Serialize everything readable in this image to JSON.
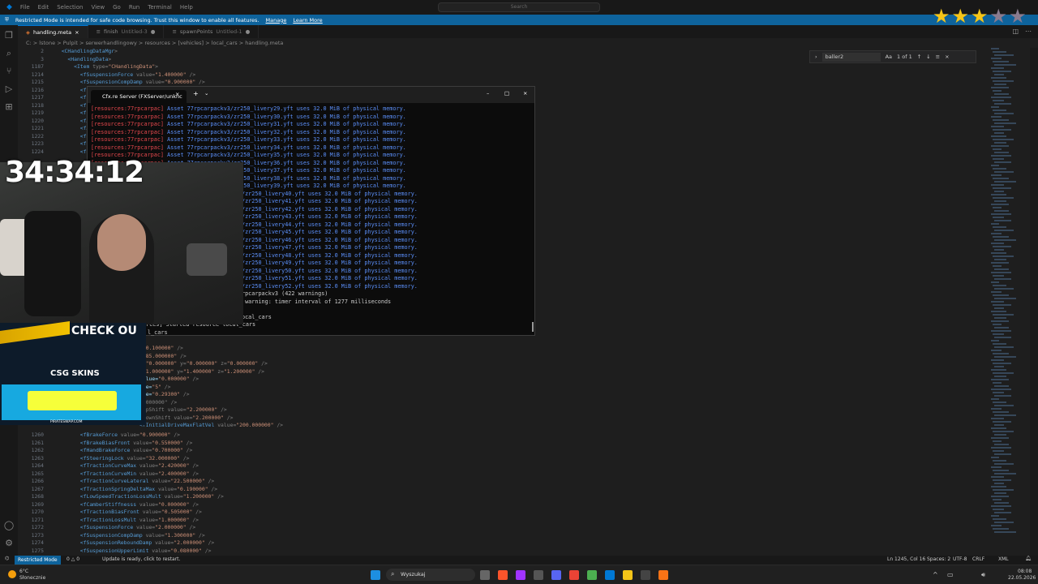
{
  "titlebar": {
    "menu": [
      "File",
      "Edit",
      "Selection",
      "View",
      "Go",
      "Run",
      "Terminal",
      "Help"
    ],
    "search_placeholder": "Search"
  },
  "banner": {
    "message": "Restricted Mode is intended for safe code browsing. Trust this window to enable all features.",
    "manage": "Manage",
    "learn_more": "Learn More"
  },
  "tabs": [
    {
      "label": "handling.meta",
      "active": true
    },
    {
      "label": "finish",
      "suffix": "Untitled-3"
    },
    {
      "label": "spawnPoints",
      "suffix": "Untitled-1"
    }
  ],
  "breadcrumb": "C: > lstone > Pulpit > serwerhandlingowy > resources > [vehicles] > local_cars > handling.meta",
  "find": {
    "query": "baller2",
    "match_case": "Aa",
    "result": "1 of 1"
  },
  "editor": {
    "top_lines": [
      {
        "n": "2",
        "text": "  <CHandlingDataMgr>"
      },
      {
        "n": "3",
        "text": "    <HandlingData>"
      },
      {
        "n": "1187",
        "text": "      <Item type=\"CHandlingData\">"
      },
      {
        "n": "1214",
        "text": "        <fSuspensionForce value=\"1.400000\" />"
      },
      {
        "n": "1215",
        "text": "        <fSuspensionCompDamp value=\"0.900000\" />"
      },
      {
        "n": "1216",
        "text": "        <fSu"
      },
      {
        "n": "1217",
        "text": "        <fSu"
      },
      {
        "n": "1218",
        "text": "        <fSu"
      },
      {
        "n": "1219",
        "text": "        <fSu"
      },
      {
        "n": "1220",
        "text": "        <fAn"
      },
      {
        "n": "1221",
        "text": "        <fAn"
      },
      {
        "n": "1222",
        "text": "        <fRo"
      },
      {
        "n": "1223",
        "text": "        <fRo"
      },
      {
        "n": "1224",
        "text": "        <fRo"
      }
    ],
    "partial_lines": [
      {
        "text": "=\"0.100000\" />"
      },
      {
        "text": "=\"85.000000\" />"
      },
      {
        "text": "d=\"0.000000\" y=\"0.000000\" z=\"0.000000\" />"
      },
      {
        "text": "=\"1.000000\" y=\"1.400000\" z=\"1.200000\" />"
      },
      {
        "text": "value=\"0.000000\" />"
      },
      {
        "text": "lue=\"5\" />"
      },
      {
        "text": "lue=\"0.29300\" />"
      },
      {
        "text": "1.000000\" />"
      },
      {
        "text": "eUpShift value=\"2.200000\" />"
      },
      {
        "text": "eDownShift value=\"2.200000\" />"
      },
      {
        "text": "<fInitialDriveMaxFlatVel value=\"200.000000\" />"
      }
    ],
    "bottom_lines": [
      {
        "n": "1260",
        "text": "        <fBrakeForce value=\"0.900000\" />"
      },
      {
        "n": "1261",
        "text": "        <fBrakeBiasFront value=\"0.550000\" />"
      },
      {
        "n": "1262",
        "text": "        <fHandBrakeForce value=\"0.700000\" />"
      },
      {
        "n": "1263",
        "text": "        <fSteeringLock value=\"32.000000\" />"
      },
      {
        "n": "1264",
        "text": "        <fTractionCurveMax value=\"2.420000\" />"
      },
      {
        "n": "1265",
        "text": "        <fTractionCurveMin value=\"2.400000\" />"
      },
      {
        "n": "1266",
        "text": "        <fTractionCurveLateral value=\"22.500000\" />"
      },
      {
        "n": "1267",
        "text": "        <fTractionSpringDeltaMax value=\"0.190000\" />"
      },
      {
        "n": "1268",
        "text": "        <fLowSpeedTractionLossMult value=\"1.200000\" />"
      },
      {
        "n": "1269",
        "text": "        <fCamberStiffnesss value=\"0.000000\" />"
      },
      {
        "n": "1270",
        "text": "        <fTractionBiasFront value=\"0.505000\" />"
      },
      {
        "n": "1271",
        "text": "        <fTractionLossMult value=\"1.000000\" />"
      },
      {
        "n": "1272",
        "text": "        <fSuspensionForce value=\"2.000000\" />"
      },
      {
        "n": "1273",
        "text": "        <fSuspensionCompDamp value=\"1.300000\" />"
      },
      {
        "n": "1274",
        "text": "        <fSuspensionReboundDamp value=\"2.000000\" />"
      },
      {
        "n": "1275",
        "text": "        <fSuspensionUpperLimit value=\"0.080000\" />"
      }
    ]
  },
  "terminal": {
    "tab_title": "Cfx.re Server (FXServer/unknc",
    "lines": [
      {
        "tag": "[resources:77rpcarpac]",
        "text": "Asset 77rpcarpackv3/zr250_livery29.yft uses 32.0 MiB of physical memory."
      },
      {
        "tag": "[resources:77rpcarpac]",
        "text": "Asset 77rpcarpackv3/zr250_livery30.yft uses 32.0 MiB of physical memory."
      },
      {
        "tag": "[resources:77rpcarpac]",
        "text": "Asset 77rpcarpackv3/zr250_livery31.yft uses 32.0 MiB of physical memory."
      },
      {
        "tag": "[resources:77rpcarpac]",
        "text": "Asset 77rpcarpackv3/zr250_livery32.yft uses 32.0 MiB of physical memory."
      },
      {
        "tag": "[resources:77rpcarpac]",
        "text": "Asset 77rpcarpackv3/zr250_livery33.yft uses 32.0 MiB of physical memory."
      },
      {
        "tag": "[resources:77rpcarpac]",
        "text": "Asset 77rpcarpackv3/zr250_livery34.yft uses 32.0 MiB of physical memory."
      },
      {
        "tag": "[resources:77rpcarpac]",
        "text": "Asset 77rpcarpackv3/zr250_livery35.yft uses 32.0 MiB of physical memory."
      },
      {
        "tag": "[resources:77rpcarpac]",
        "text": "Asset 77rpcarpackv3/zr250_livery36.yft uses 32.0 MiB of physical memory."
      },
      {
        "tag": "[resources:77rpcarpac]",
        "text": "Asset 77rpcarpackv3/zr250_livery37.yft uses 32.0 MiB of physical memory."
      },
      {
        "tag": "[resources:77rpcarpac]",
        "text": "Asset 77rpcarpackv3/zr250_livery38.yft uses 32.0 MiB of physical memory."
      },
      {
        "tag": "[resources:77rpcarpac]",
        "text": "Asset 77rpcarpackv3/zr250_livery39.yft uses 32.0 MiB of physical memory."
      }
    ],
    "partial_lines": [
      "/zr250_livery40.yft uses 32.0 MiB of physical memory.",
      "/zr250_livery41.yft uses 32.0 MiB of physical memory.",
      "/zr250_livery42.yft uses 32.0 MiB of physical memory.",
      "/zr250_livery43.yft uses 32.0 MiB of physical memory.",
      "/zr250_livery44.yft uses 32.0 MiB of physical memory.",
      "/zr250_livery45.yft uses 32.0 MiB of physical memory.",
      "/zr250_livery46.yft uses 32.0 MiB of physical memory.",
      "/zr250_livery47.yft uses 32.0 MiB of physical memory.",
      "/zr250_livery48.yft uses 32.0 MiB of physical memory.",
      "/zr250_livery49.yft uses 32.0 MiB of physical memory.",
      "/zr250_livery50.yft uses 32.0 MiB of physical memory.",
      "/zr250_livery51.yft uses 32.0 MiB of physical memory.",
      "/zr250_livery52.yft uses 32.0 MiB of physical memory."
    ],
    "tail": {
      "warnings": "rpcarpackv3 (422 warnings)",
      "timer": " warning: timer interval of 1277 milliseconds",
      "local": "ocal_cars",
      "started": "urces] Started resource local_cars",
      "cursor": "l_cars"
    }
  },
  "overlay": {
    "timer": "34:34:12",
    "stars_filled": 3,
    "stars_total": 5,
    "check_out": "CHECK OU",
    "csg_skins": "CSG SKINS",
    "footer": "PIRATESWAP.COM"
  },
  "status": {
    "restricted": "Restricted Mode",
    "problems": "0 △ 0",
    "update": "Update is ready, click to restart.",
    "position": "Ln 1245, Col 16",
    "spaces": "Spaces: 2",
    "encoding": "UTF-8",
    "eol": "CRLF",
    "lang": "XML"
  },
  "taskbar": {
    "weather_temp": "6°C",
    "weather_desc": "Słonecznie",
    "search": "Wyszukaj",
    "time": "08:08",
    "date": "22.05.2026"
  },
  "colors": {
    "accent": "#0078d4",
    "banner": "#0e639c",
    "tag_red": "#e5484d",
    "term_blue": "#5b8ff9"
  }
}
